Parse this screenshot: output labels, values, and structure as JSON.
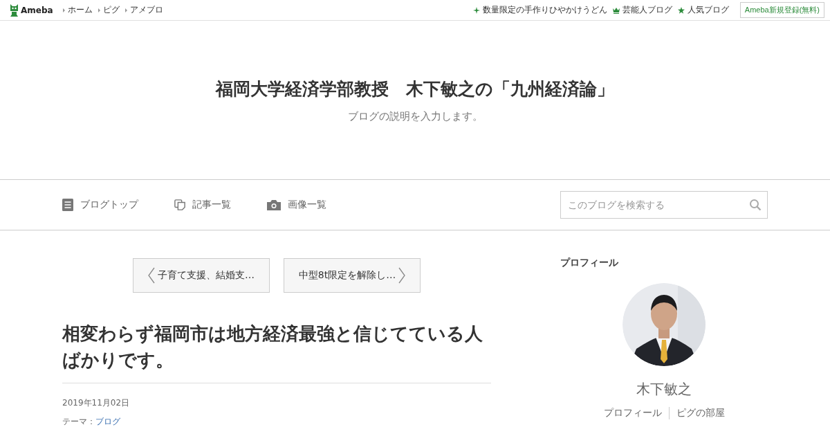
{
  "topbar": {
    "logo": "Ameba",
    "links": [
      "ホーム",
      "ピグ",
      "アメブロ"
    ],
    "promos": [
      {
        "kind": "sparkle",
        "label": "数量限定の手作りひやかけうどん"
      },
      {
        "kind": "crown",
        "label": "芸能人ブログ"
      },
      {
        "kind": "star",
        "label": "人気ブログ"
      }
    ],
    "signup": "Ameba新規登録(無料)"
  },
  "header": {
    "title": "福岡大学経済学部教授　木下敏之の「九州経済論」",
    "description": "ブログの説明を入力します。"
  },
  "nav": {
    "items": [
      {
        "kind": "document",
        "label": "ブログトップ"
      },
      {
        "kind": "copy",
        "label": "記事一覧"
      },
      {
        "kind": "camera",
        "label": "画像一覧"
      }
    ],
    "search": {
      "placeholder": "このブログを検索する"
    }
  },
  "pager": {
    "prev": "子育て支援、結婚支…",
    "next": "中型8t限定を解除し…"
  },
  "article": {
    "title": "相変わらず福岡市は地方経済最強と信じてている人ばかりです。",
    "date": "2019年11月02日",
    "theme_label": "テーマ：",
    "theme": "ブログ"
  },
  "sidebar": {
    "heading": "プロフィール",
    "avatar": {
      "kind": "picture"
    },
    "name": "木下敏之",
    "links": [
      "プロフィール",
      "ピグの部屋"
    ]
  }
}
